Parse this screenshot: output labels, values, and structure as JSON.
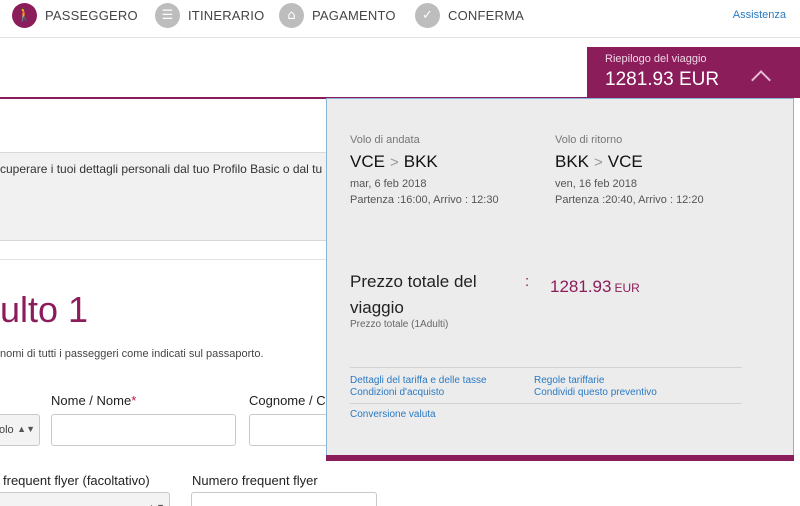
{
  "steps": [
    {
      "label": "PASSEGGERO",
      "icon": "walking-person-icon",
      "active": true
    },
    {
      "label": "ITINERARIO",
      "icon": "itinerary-icon",
      "active": false
    },
    {
      "label": "PAGAMENTO",
      "icon": "payment-icon",
      "active": false
    },
    {
      "label": "CONFERMA",
      "icon": "confirm-icon",
      "active": false
    }
  ],
  "assist_label": "Assistenza",
  "summary": {
    "title": "Riepilogo del viaggio",
    "price": "1281.93 EUR"
  },
  "page": {
    "info_text": "cuperare i tuoi dettagli personali dal tuo Profilo Basic o dal tu",
    "passenger_heading": "ulto 1",
    "names_note": "nomi di tutti i passeggeri come indicati sul passaporto.",
    "nome_label": "Nome / Nome",
    "required_mark": "*",
    "cognome_label": "Cognome / C",
    "title_select_value": "olo",
    "ff_program_label": "frequent flyer (facoltativo)",
    "ff_number_label": "Numero frequent flyer",
    "ff_select_value": "-- --"
  },
  "trip": {
    "outbound": {
      "header": "Volo di andata",
      "from": "VCE",
      "to": "BKK",
      "date": "mar, 6 feb 2018",
      "times": "Partenza :16:00, Arrivo : 12:30"
    },
    "return": {
      "header": "Volo di ritorno",
      "from": "BKK",
      "to": "VCE",
      "date": "ven, 16 feb 2018",
      "times": "Partenza :20:40, Arrivo : 12:20"
    },
    "total_label": "Prezzo totale del viaggio",
    "total_sub": "Prezzo totale (1Adulti)",
    "separator": ":",
    "total_value": "1281.93",
    "currency": "EUR"
  },
  "links": {
    "fare_details": "Dettagli del tariffa e delle tasse",
    "purchase_conditions": "Condizioni d'acquisto",
    "fare_rules": "Regole tariffarie",
    "share_quote": "Condividi questo preventivo",
    "currency_conversion": "Conversione valuta"
  },
  "colors": {
    "brand": "#8c1d5b",
    "link": "#2a7ac2"
  }
}
